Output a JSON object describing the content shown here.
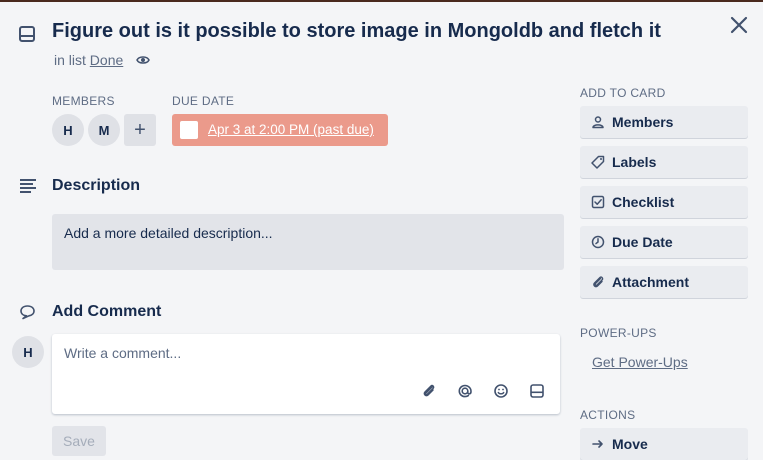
{
  "card": {
    "title": "Figure out is it possible to store image in Mongoldb and fletch it",
    "in_list_prefix": "in list",
    "list_name": "Done"
  },
  "members": {
    "label": "MEMBERS",
    "items": [
      "H",
      "M"
    ],
    "add_symbol": "+"
  },
  "due_date": {
    "label": "DUE DATE",
    "value": "Apr 3 at 2:00 PM (past due)",
    "color": "#eb9a8b"
  },
  "description": {
    "title": "Description",
    "placeholder": "Add a more detailed description..."
  },
  "comment": {
    "title": "Add Comment",
    "avatar": "H",
    "placeholder": "Write a comment...",
    "save_label": "Save",
    "tools": [
      "attachment-icon",
      "mention-icon",
      "emoji-icon",
      "card-icon"
    ]
  },
  "sidebar": {
    "add_to_card_label": "ADD TO CARD",
    "buttons": [
      {
        "label": "Members",
        "icon": "person-icon"
      },
      {
        "label": "Labels",
        "icon": "tag-icon"
      },
      {
        "label": "Checklist",
        "icon": "checkbox-icon"
      },
      {
        "label": "Due Date",
        "icon": "clock-icon"
      },
      {
        "label": "Attachment",
        "icon": "paperclip-icon"
      }
    ],
    "powerups_label": "POWER-UPS",
    "get_powerups": "Get Power-Ups",
    "actions_label": "ACTIONS",
    "actions_first": "Move"
  }
}
